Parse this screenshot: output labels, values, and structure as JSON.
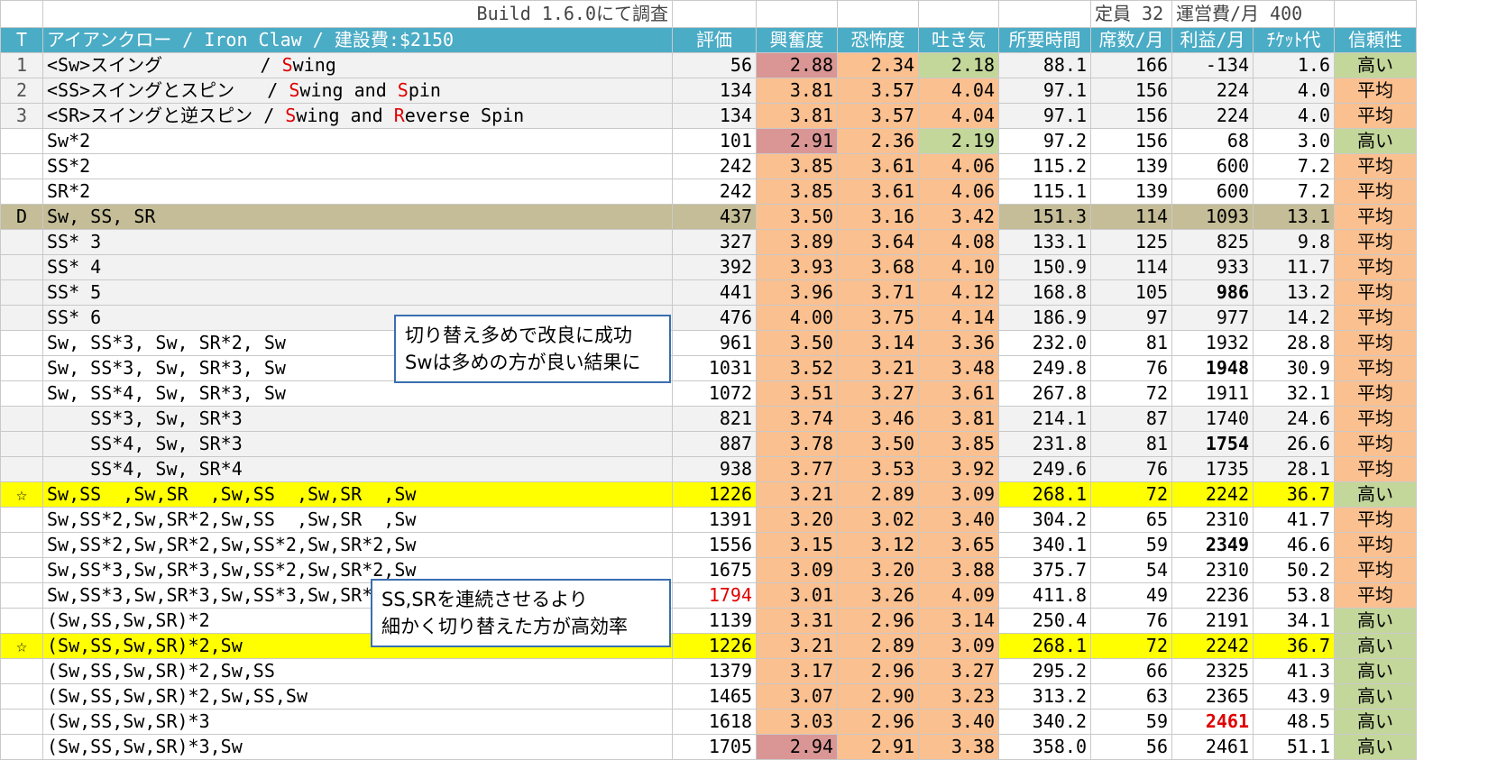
{
  "meta": {
    "build": "Build 1.6.0にて調査",
    "capacity": "定員 32",
    "op_cost": "運営費/月 400"
  },
  "header": {
    "t": "T",
    "title": "アイアンクロー / Iron Claw / 建設費:$2150",
    "cols": [
      "評価",
      "興奮度",
      "恐怖度",
      "吐き気",
      "所要時間",
      "席数/月",
      "利益/月",
      "ﾁｹｯﾄ代",
      "信頼性"
    ]
  },
  "colors": {
    "header": "#4bacc6",
    "hl_yellow": "#ffff00",
    "row_d": "#c4bd97",
    "light_gray": "#f2f2f2",
    "exc_orange": "#fac090",
    "exc_pink": "#da9694",
    "nausea_green": "#c4d79b",
    "red": "#e00000"
  },
  "callouts": [
    {
      "lines": [
        "切り替え多めで改良に成功",
        "Swは多めの方が良い結果に"
      ]
    },
    {
      "lines": [
        "SS,SRを連続させるより",
        "細かく切り替えた方が高効率"
      ]
    }
  ],
  "rows": [
    {
      "t": "1",
      "segs": [
        {
          "t": "<Sw>スイング         / "
        },
        {
          "t": "S",
          "c": "red"
        },
        {
          "t": "wing"
        }
      ],
      "v": [
        "56",
        "2.88",
        "2.34",
        "2.18",
        "88.1",
        "166",
        "-134",
        "1.6",
        "高い"
      ]
    },
    {
      "t": "2",
      "segs": [
        {
          "t": "<SS>スイングとスピン   / "
        },
        {
          "t": "S",
          "c": "red"
        },
        {
          "t": "wing and "
        },
        {
          "t": "S",
          "c": "red"
        },
        {
          "t": "pin"
        }
      ],
      "v": [
        "134",
        "3.81",
        "3.57",
        "4.04",
        "97.1",
        "156",
        "224",
        "4.0",
        "平均"
      ]
    },
    {
      "t": "3",
      "segs": [
        {
          "t": "<SR>スイングと逆スピン / "
        },
        {
          "t": "S",
          "c": "red"
        },
        {
          "t": "wing and "
        },
        {
          "t": "R",
          "c": "red"
        },
        {
          "t": "everse Spin"
        }
      ],
      "v": [
        "134",
        "3.81",
        "3.57",
        "4.04",
        "97.1",
        "156",
        "224",
        "4.0",
        "平均"
      ]
    },
    {
      "t": "",
      "segs": [
        {
          "t": "Sw*2"
        }
      ],
      "v": [
        "101",
        "2.91",
        "2.36",
        "2.19",
        "97.2",
        "156",
        "68",
        "3.0",
        "高い"
      ]
    },
    {
      "t": "",
      "segs": [
        {
          "t": "SS*2"
        }
      ],
      "v": [
        "242",
        "3.85",
        "3.61",
        "4.06",
        "115.2",
        "139",
        "600",
        "7.2",
        "平均"
      ]
    },
    {
      "t": "",
      "segs": [
        {
          "t": "SR*2"
        }
      ],
      "v": [
        "242",
        "3.85",
        "3.61",
        "4.06",
        "115.1",
        "139",
        "600",
        "7.2",
        "平均"
      ]
    },
    {
      "t": "D",
      "segs": [
        {
          "t": "Sw, SS, SR"
        }
      ],
      "v": [
        "437",
        "3.50",
        "3.16",
        "3.42",
        "151.3",
        "114",
        "1093",
        "13.1",
        "平均"
      ]
    },
    {
      "t": "",
      "segs": [
        {
          "t": "SS* 3"
        }
      ],
      "v": [
        "327",
        "3.89",
        "3.64",
        "4.08",
        "133.1",
        "125",
        "825",
        "9.8",
        "平均"
      ]
    },
    {
      "t": "",
      "segs": [
        {
          "t": "SS* 4"
        }
      ],
      "v": [
        "392",
        "3.93",
        "3.68",
        "4.10",
        "150.9",
        "114",
        "933",
        "11.7",
        "平均"
      ]
    },
    {
      "t": "",
      "segs": [
        {
          "t": "SS* 5"
        }
      ],
      "v": [
        "441",
        "3.96",
        "3.71",
        "4.12",
        "168.8",
        "105",
        "986",
        "13.2",
        "平均"
      ]
    },
    {
      "t": "",
      "segs": [
        {
          "t": "SS* 6"
        }
      ],
      "v": [
        "476",
        "4.00",
        "3.75",
        "4.14",
        "186.9",
        "97",
        "977",
        "14.2",
        "平均"
      ]
    },
    {
      "t": "",
      "segs": [
        {
          "t": "Sw, SS*3, Sw, SR*2, Sw"
        }
      ],
      "v": [
        "961",
        "3.50",
        "3.14",
        "3.36",
        "232.0",
        "81",
        "1932",
        "28.8",
        "平均"
      ]
    },
    {
      "t": "",
      "segs": [
        {
          "t": "Sw, SS*3, Sw, SR*3, Sw"
        }
      ],
      "v": [
        "1031",
        "3.52",
        "3.21",
        "3.48",
        "249.8",
        "76",
        "1948",
        "30.9",
        "平均"
      ]
    },
    {
      "t": "",
      "segs": [
        {
          "t": "Sw, SS*4, Sw, SR*3, Sw"
        }
      ],
      "v": [
        "1072",
        "3.51",
        "3.27",
        "3.61",
        "267.8",
        "72",
        "1911",
        "32.1",
        "平均"
      ]
    },
    {
      "t": "",
      "segs": [
        {
          "t": "    SS*3, Sw, SR*3"
        }
      ],
      "v": [
        "821",
        "3.74",
        "3.46",
        "3.81",
        "214.1",
        "87",
        "1740",
        "24.6",
        "平均"
      ]
    },
    {
      "t": "",
      "segs": [
        {
          "t": "    SS*4, Sw, SR*3"
        }
      ],
      "v": [
        "887",
        "3.78",
        "3.50",
        "3.85",
        "231.8",
        "81",
        "1754",
        "26.6",
        "平均"
      ]
    },
    {
      "t": "",
      "segs": [
        {
          "t": "    SS*4, Sw, SR*4"
        }
      ],
      "v": [
        "938",
        "3.77",
        "3.53",
        "3.92",
        "249.6",
        "76",
        "1735",
        "28.1",
        "平均"
      ]
    },
    {
      "t": "☆",
      "segs": [
        {
          "t": "Sw,SS  ,Sw,SR  ,Sw,SS  ,Sw,SR  ,Sw"
        }
      ],
      "v": [
        "1226",
        "3.21",
        "2.89",
        "3.09",
        "268.1",
        "72",
        "2242",
        "36.7",
        "高い"
      ]
    },
    {
      "t": "",
      "segs": [
        {
          "t": "Sw,SS*2,Sw,SR*2,Sw,SS  ,Sw,SR  ,Sw"
        }
      ],
      "v": [
        "1391",
        "3.20",
        "3.02",
        "3.40",
        "304.2",
        "65",
        "2310",
        "41.7",
        "平均"
      ]
    },
    {
      "t": "",
      "segs": [
        {
          "t": "Sw,SS*2,Sw,SR*2,Sw,SS*2,Sw,SR*2,Sw"
        }
      ],
      "v": [
        "1556",
        "3.15",
        "3.12",
        "3.65",
        "340.1",
        "59",
        "2349",
        "46.6",
        "平均"
      ]
    },
    {
      "t": "",
      "segs": [
        {
          "t": "Sw,SS*3,Sw,SR*3,Sw,SS*2,Sw,SR*2,Sw"
        }
      ],
      "v": [
        "1675",
        "3.09",
        "3.20",
        "3.88",
        "375.7",
        "54",
        "2310",
        "50.2",
        "平均"
      ]
    },
    {
      "t": "",
      "segs": [
        {
          "t": "Sw,SS*3,Sw,SR*3,Sw,SS*3,Sw,SR*3,Sw"
        }
      ],
      "v": [
        "1794",
        "3.01",
        "3.26",
        "4.09",
        "411.8",
        "49",
        "2236",
        "53.8",
        "平均"
      ]
    },
    {
      "t": "",
      "segs": [
        {
          "t": "(Sw,SS,Sw,SR)*2"
        }
      ],
      "v": [
        "1139",
        "3.31",
        "2.96",
        "3.14",
        "250.4",
        "76",
        "2191",
        "34.1",
        "高い"
      ]
    },
    {
      "t": "☆",
      "segs": [
        {
          "t": "(Sw,SS,Sw,SR)*2,Sw"
        }
      ],
      "v": [
        "1226",
        "3.21",
        "2.89",
        "3.09",
        "268.1",
        "72",
        "2242",
        "36.7",
        "高い"
      ]
    },
    {
      "t": "",
      "segs": [
        {
          "t": "(Sw,SS,Sw,SR)*2,Sw,SS"
        }
      ],
      "v": [
        "1379",
        "3.17",
        "2.96",
        "3.27",
        "295.2",
        "66",
        "2325",
        "41.3",
        "高い"
      ]
    },
    {
      "t": "",
      "segs": [
        {
          "t": "(Sw,SS,Sw,SR)*2,Sw,SS,Sw"
        }
      ],
      "v": [
        "1465",
        "3.07",
        "2.90",
        "3.23",
        "313.2",
        "63",
        "2365",
        "43.9",
        "高い"
      ]
    },
    {
      "t": "",
      "segs": [
        {
          "t": "(Sw,SS,Sw,SR)*3"
        }
      ],
      "v": [
        "1618",
        "3.03",
        "2.96",
        "3.40",
        "340.2",
        "59",
        "2461",
        "48.5",
        "高い"
      ]
    },
    {
      "t": "",
      "segs": [
        {
          "t": "(Sw,SS,Sw,SR)*3,Sw"
        }
      ],
      "v": [
        "1705",
        "2.94",
        "2.91",
        "3.38",
        "358.0",
        "56",
        "2461",
        "51.1",
        "高い"
      ]
    }
  ]
}
